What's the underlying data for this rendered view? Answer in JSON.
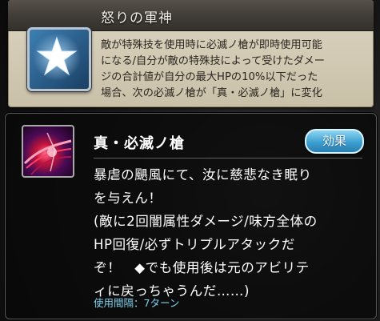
{
  "passive": {
    "title": "怒りの軍神",
    "icon": "star-icon",
    "description_lines": [
      "敵が特殊技を使用時に必滅ノ槍が即時使用可能",
      "になる/自分が敵の特殊技によって受けたダメー",
      "ジの合計値が自分の最大HPの10%以下だった",
      "場合、次の必滅ノ槍が「真・必滅ノ槍」に変化"
    ]
  },
  "skill": {
    "icon": "spear-skill-icon",
    "name": "真・必滅ノ槍",
    "effect_button": "効果",
    "description_lines": [
      "暴虐の颶風にて、汝に慈悲なき眠り",
      "を与えん！",
      "(敵に2回闇属性ダメージ/味方全体の",
      "HP回復/必ずトリプルアタックだ",
      "ぞ！　◆でも使用後は元のアビリテ",
      "ィに戻っちゃうんだ……)"
    ],
    "cooldown": "使用間隔：7ターン"
  },
  "colors": {
    "accent": "#3c9fd0",
    "cooldown_text": "#7fd2ee",
    "passive_bg": "#d5cdb7"
  }
}
